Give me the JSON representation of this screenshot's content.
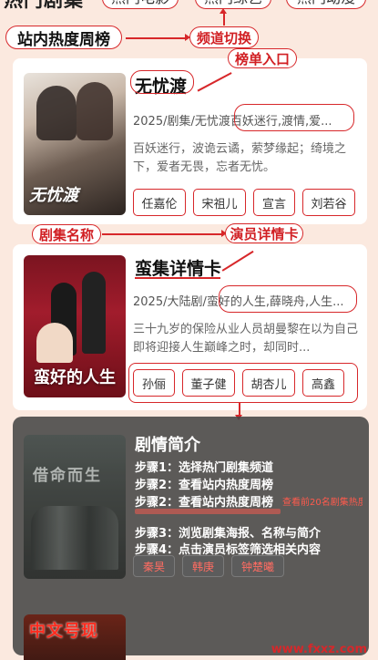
{
  "tabs": {
    "active": "热门剧集",
    "items": [
      "热门电影",
      "热门综艺",
      "热门动漫"
    ]
  },
  "callouts": {
    "hot_rank": "站内热度周榜",
    "channel_switch": "频道切换",
    "rank_entry": "榜单入口",
    "show_name": "剧集名称",
    "actor_card": "演员详情卡"
  },
  "shows": [
    {
      "title": "无忧渡",
      "poster_text": "无忧渡",
      "meta_prefix": "2025/剧集/无忧渡",
      "meta_tags": "百妖迷行,渡情,爱...",
      "synopsis": "百妖迷行，波诡云谲，萦梦缘起；绮境之下，爱者无畏，忘者无忧。",
      "actors": [
        "任嘉伦",
        "宋祖儿",
        "宣言",
        "刘若谷"
      ]
    },
    {
      "title": "蛮集详情卡",
      "poster_text": "蛮好的人生",
      "meta_prefix": "2025/大陆剧/蛮",
      "meta_tags": "好的人生,薛晓舟,人生...",
      "synopsis": "三十九岁的保险从业人员胡曼黎在以为自己即将迎接人生巅峰之时，却同时...",
      "actors": [
        "孙俪",
        "董子健",
        "胡杏儿",
        "高鑫"
      ]
    }
  ],
  "intro": {
    "poster_text": "借命而生",
    "title": "剧情简介",
    "steps": [
      "步骤1：选择热门剧集频道",
      "步骤2：查看站内热度周榜",
      "步骤2：查看站内热度周榜",
      "步骤3：浏览剧集海报、名称与简介",
      "步骤4：点击演员标签筛选相关内容"
    ],
    "step_note": "查看前20名剧集热度排行",
    "actors": [
      "秦昊",
      "韩庚",
      "钟楚曦"
    ]
  },
  "bottom_poster_text": "中文号现",
  "watermark": "www.fxxz.com",
  "colors": {
    "accent": "#d7272a",
    "background": "#fbe9df",
    "overlay": "#464646"
  }
}
